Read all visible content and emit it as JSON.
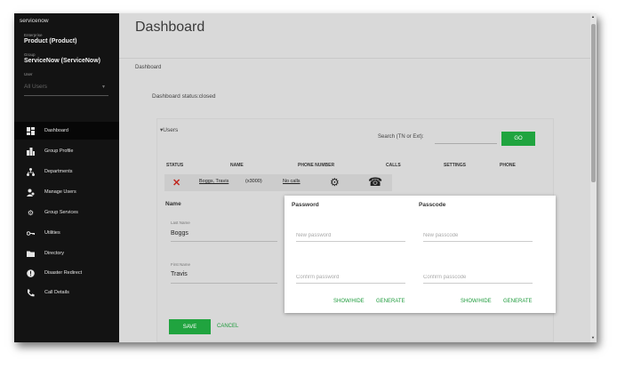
{
  "sidebar": {
    "brand": "servicenow",
    "enterprise_label": "Enterprise",
    "enterprise_value": "Product (Product)",
    "group_label": "Group",
    "group_value": "ServiceNow (ServiceNow)",
    "user_label": "User",
    "user_value": "All Users",
    "items": [
      {
        "label": "Dashboard",
        "icon": "dashboard-icon"
      },
      {
        "label": "Group Profile",
        "icon": "building-icon"
      },
      {
        "label": "Departments",
        "icon": "hierarchy-icon"
      },
      {
        "label": "Manage Users",
        "icon": "users-icon"
      },
      {
        "label": "Group Services",
        "icon": "gear-icon"
      },
      {
        "label": "Utilities",
        "icon": "key-icon"
      },
      {
        "label": "Directory",
        "icon": "folder-icon"
      },
      {
        "label": "Disaster Redirect",
        "icon": "alert-icon"
      },
      {
        "label": "Call Details",
        "icon": "phone-icon"
      }
    ]
  },
  "header": {
    "title": "Dashboard",
    "breadcrumb": "Dashboard",
    "status": "Dashboard status:closed"
  },
  "users_panel": {
    "toggle_label": "Users",
    "search_label": "Search (TN or Ext):",
    "search_value": "",
    "go_label": "GO",
    "columns": [
      "STATUS",
      "NAME",
      "PHONE NUMBER",
      "CALLS",
      "SETTINGS",
      "PHONE"
    ],
    "row": {
      "name": "Boggs, Travis",
      "ext": "(x3000)",
      "calls": "No calls"
    }
  },
  "name_section": {
    "title": "Name",
    "last_name_label": "Last Name",
    "last_name_value": "Boggs",
    "first_name_label": "First Name",
    "first_name_value": "Travis"
  },
  "password_section": {
    "password_title": "Password",
    "passcode_title": "Passcode",
    "new_password_placeholder": "New password",
    "confirm_password_placeholder": "Confirm password",
    "new_passcode_placeholder": "New passcode",
    "confirm_passcode_placeholder": "Confirm passcode",
    "show_hide_label": "SHOW/HIDE",
    "generate_label": "GENERATE"
  },
  "actions": {
    "save_label": "SAVE",
    "cancel_label": "CANCEL"
  },
  "colors": {
    "accent_green": "#20a43f",
    "sidebar_bg": "#131313",
    "status_red": "#c0271f"
  }
}
